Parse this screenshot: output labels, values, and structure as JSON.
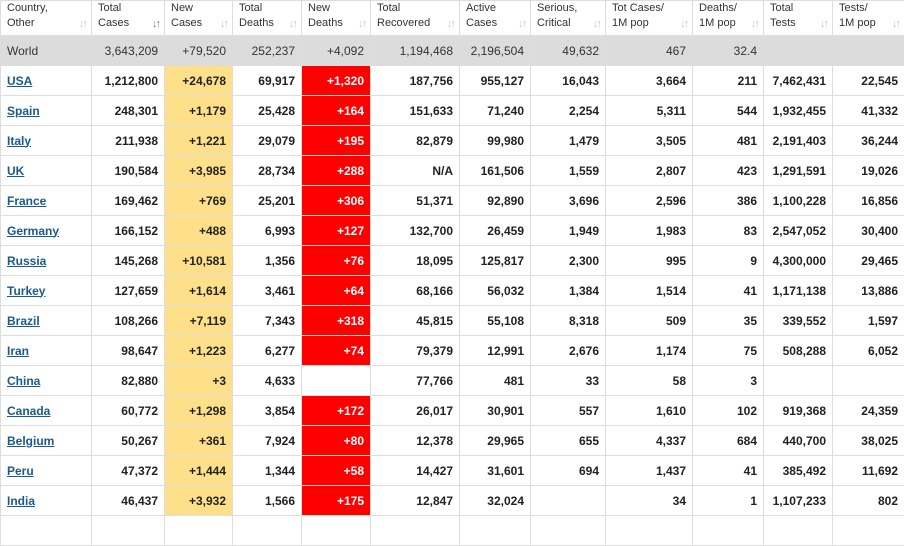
{
  "columns": [
    {
      "l1": "Country,",
      "l2": "Other",
      "sort": "up"
    },
    {
      "l1": "Total",
      "l2": "Cases",
      "sort": "active"
    },
    {
      "l1": "New",
      "l2": "Cases",
      "sort": "up"
    },
    {
      "l1": "Total",
      "l2": "Deaths",
      "sort": "up"
    },
    {
      "l1": "New",
      "l2": "Deaths",
      "sort": "up"
    },
    {
      "l1": "Total",
      "l2": "Recovered",
      "sort": "up"
    },
    {
      "l1": "Active",
      "l2": "Cases",
      "sort": "up"
    },
    {
      "l1": "Serious,",
      "l2": "Critical",
      "sort": "up"
    },
    {
      "l1": "Tot Cases/",
      "l2": "1M pop",
      "sort": "up"
    },
    {
      "l1": "Deaths/",
      "l2": "1M pop",
      "sort": "up"
    },
    {
      "l1": "Total",
      "l2": "Tests",
      "sort": "up"
    },
    {
      "l1": "Tests/",
      "l2": "1M pop",
      "sort": "up"
    }
  ],
  "sort_icons": {
    "up": "↓↑",
    "active": "↓↑"
  },
  "world": [
    "World",
    "3,643,209",
    "+79,520",
    "252,237",
    "+4,092",
    "1,194,468",
    "2,196,504",
    "49,632",
    "467",
    "32.4",
    "",
    ""
  ],
  "rows": [
    [
      "USA",
      "1,212,800",
      "+24,678",
      "69,917",
      "+1,320",
      "187,756",
      "955,127",
      "16,043",
      "3,664",
      "211",
      "7,462,431",
      "22,545"
    ],
    [
      "Spain",
      "248,301",
      "+1,179",
      "25,428",
      "+164",
      "151,633",
      "71,240",
      "2,254",
      "5,311",
      "544",
      "1,932,455",
      "41,332"
    ],
    [
      "Italy",
      "211,938",
      "+1,221",
      "29,079",
      "+195",
      "82,879",
      "99,980",
      "1,479",
      "3,505",
      "481",
      "2,191,403",
      "36,244"
    ],
    [
      "UK",
      "190,584",
      "+3,985",
      "28,734",
      "+288",
      "N/A",
      "161,506",
      "1,559",
      "2,807",
      "423",
      "1,291,591",
      "19,026"
    ],
    [
      "France",
      "169,462",
      "+769",
      "25,201",
      "+306",
      "51,371",
      "92,890",
      "3,696",
      "2,596",
      "386",
      "1,100,228",
      "16,856"
    ],
    [
      "Germany",
      "166,152",
      "+488",
      "6,993",
      "+127",
      "132,700",
      "26,459",
      "1,949",
      "1,983",
      "83",
      "2,547,052",
      "30,400"
    ],
    [
      "Russia",
      "145,268",
      "+10,581",
      "1,356",
      "+76",
      "18,095",
      "125,817",
      "2,300",
      "995",
      "9",
      "4,300,000",
      "29,465"
    ],
    [
      "Turkey",
      "127,659",
      "+1,614",
      "3,461",
      "+64",
      "68,166",
      "56,032",
      "1,384",
      "1,514",
      "41",
      "1,171,138",
      "13,886"
    ],
    [
      "Brazil",
      "108,266",
      "+7,119",
      "7,343",
      "+318",
      "45,815",
      "55,108",
      "8,318",
      "509",
      "35",
      "339,552",
      "1,597"
    ],
    [
      "Iran",
      "98,647",
      "+1,223",
      "6,277",
      "+74",
      "79,379",
      "12,991",
      "2,676",
      "1,174",
      "75",
      "508,288",
      "6,052"
    ],
    [
      "China",
      "82,880",
      "+3",
      "4,633",
      "",
      "77,766",
      "481",
      "33",
      "58",
      "3",
      "",
      ""
    ],
    [
      "Canada",
      "60,772",
      "+1,298",
      "3,854",
      "+172",
      "26,017",
      "30,901",
      "557",
      "1,610",
      "102",
      "919,368",
      "24,359"
    ],
    [
      "Belgium",
      "50,267",
      "+361",
      "7,924",
      "+80",
      "12,378",
      "29,965",
      "655",
      "4,337",
      "684",
      "440,700",
      "38,025"
    ],
    [
      "Peru",
      "47,372",
      "+1,444",
      "1,344",
      "+58",
      "14,427",
      "31,601",
      "694",
      "1,437",
      "41",
      "385,492",
      "11,692"
    ],
    [
      "India",
      "46,437",
      "+3,932",
      "1,566",
      "+175",
      "12,847",
      "32,024",
      "",
      "34",
      "1",
      "1,107,233",
      "802"
    ],
    [
      "",
      "",
      "",
      "",
      "",
      "",
      "",
      "",
      "",
      "",
      "",
      ""
    ]
  ],
  "colors": {
    "new_cases_bg": "#ffe08a",
    "new_deaths_bg": "#ff0000",
    "world_row_bg": "#dcdcdc",
    "link": "#1a5a8c"
  }
}
